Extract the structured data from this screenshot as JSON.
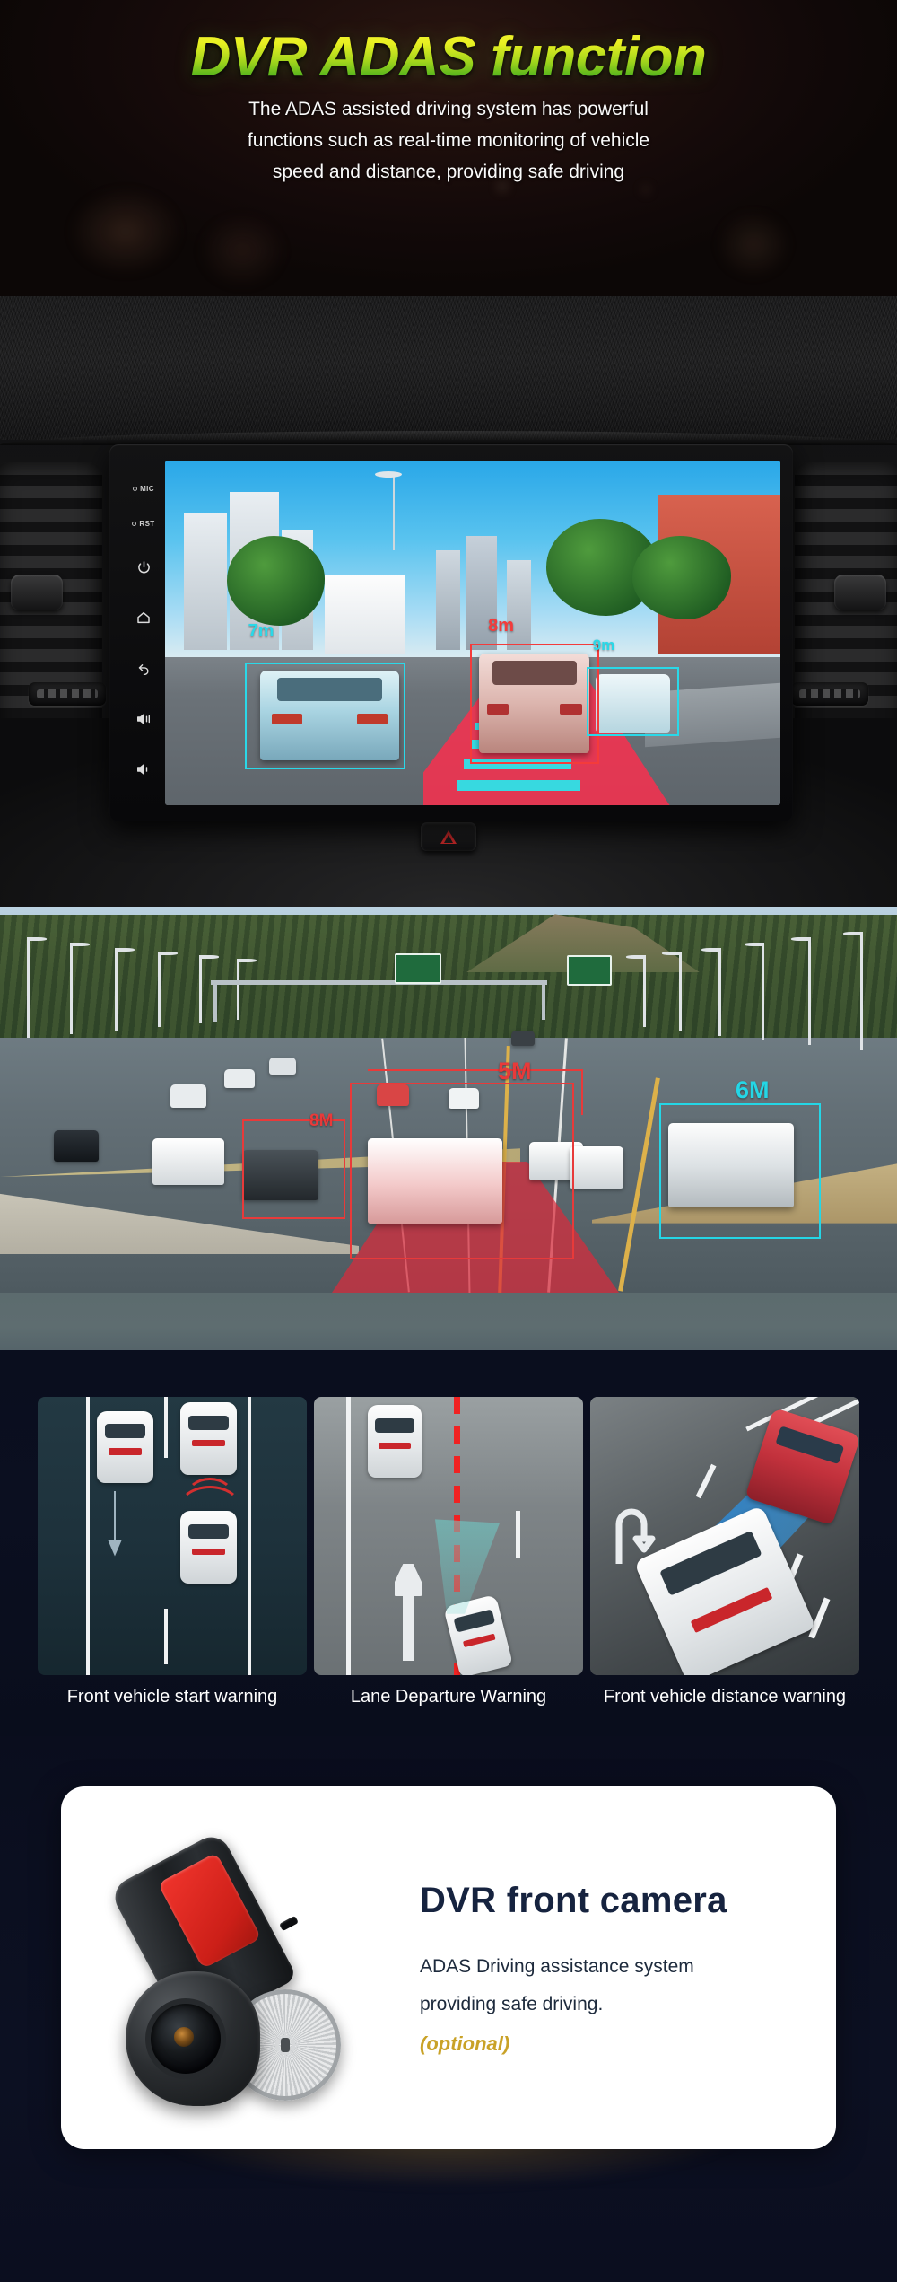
{
  "hero": {
    "title": "DVR ADAS function",
    "subtitle_lines": [
      "The ADAS assisted driving system has powerful",
      "functions such as real-time monitoring of vehicle",
      "speed and distance, providing safe driving"
    ]
  },
  "head_unit": {
    "side_buttons": [
      {
        "name": "mic-label",
        "label": "MIC"
      },
      {
        "name": "reset-label",
        "label": "RST"
      },
      {
        "name": "power-button",
        "label": ""
      },
      {
        "name": "home-button",
        "label": ""
      },
      {
        "name": "back-button",
        "label": ""
      },
      {
        "name": "volume-up-button",
        "label": ""
      },
      {
        "name": "volume-down-button",
        "label": ""
      }
    ],
    "distance_labels": [
      {
        "text": "7m",
        "color": "#2ad8e8"
      },
      {
        "text": "8m",
        "color": "#f43b3b"
      },
      {
        "text": "9m",
        "color": "#2ad8e8"
      }
    ],
    "hazard_button_label": ""
  },
  "highway": {
    "distance_labels": [
      {
        "text": "8M",
        "color": "#e83a3a"
      },
      {
        "text": "5M",
        "color": "#e83a3a"
      },
      {
        "text": "6M",
        "color": "#24d6e6"
      }
    ]
  },
  "features": {
    "cards": [
      {
        "label": "Front vehicle start warning"
      },
      {
        "label": "Lane Departure Warning"
      },
      {
        "label": "Front vehicle distance warning"
      }
    ]
  },
  "dvr_camera": {
    "title": "DVR front camera",
    "body_lines": [
      "ADAS Driving assistance system",
      "providing safe driving."
    ],
    "optional_note": "(optional)"
  },
  "colors": {
    "title_gradient_top": "#f5f538",
    "title_gradient_bottom": "#2c8f1b",
    "cyan_marker": "#24d6e6",
    "red_marker": "#e83a3a",
    "optional_gold": "#c9a227",
    "card_title_navy": "#16233f",
    "page_background": "#0b0f20"
  }
}
